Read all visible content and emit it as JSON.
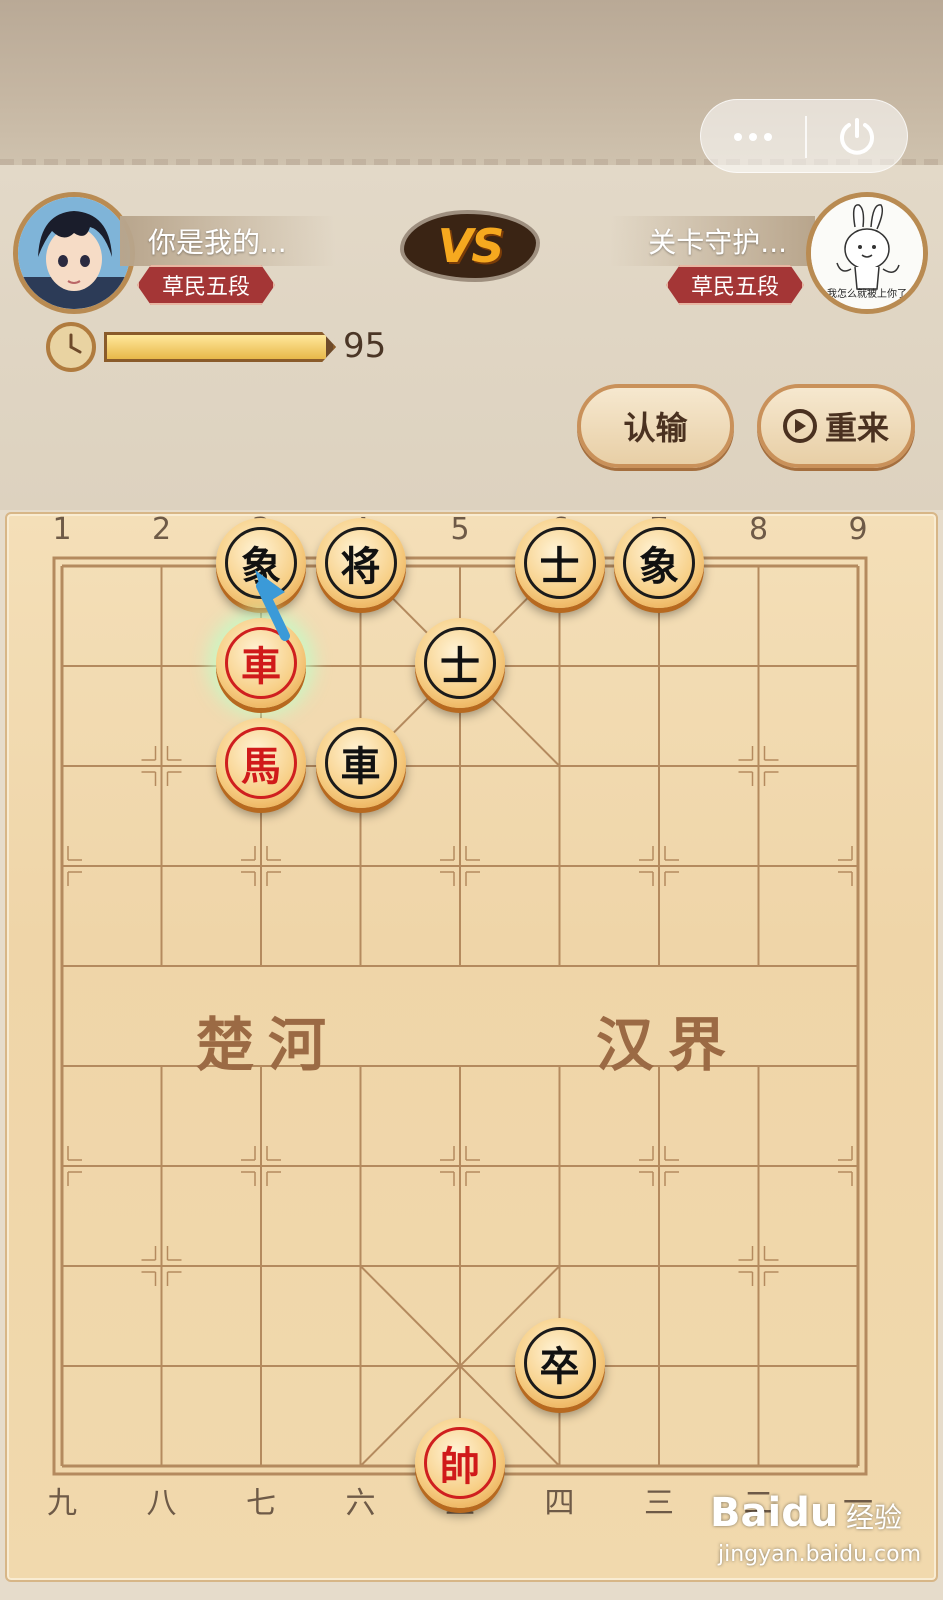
{
  "colors": {
    "red_piece": "#d01a1a",
    "black_piece": "#111111",
    "board": "#f1d9ad",
    "rank_badge": "#a43636",
    "vs": "#f6a91f"
  },
  "player_self": {
    "name": "你是我的...",
    "rank": "草民五段"
  },
  "player_opponent": {
    "name": "关卡守护...",
    "rank": "草民五段",
    "avatar_caption": "我怎么就被上你了"
  },
  "vs_label": "VS",
  "timer": {
    "value": "95",
    "fill_fraction": 0.97
  },
  "buttons": {
    "resign": "认输",
    "restart": "重来"
  },
  "capsule": {
    "more_icon": "more-dots-icon",
    "close_icon": "power-icon"
  },
  "board": {
    "top_files": [
      "1",
      "2",
      "3",
      "4",
      "5",
      "6",
      "7",
      "8",
      "9"
    ],
    "bottom_files": [
      "九",
      "八",
      "七",
      "六",
      "五",
      "四",
      "三",
      "二",
      "一"
    ],
    "river_left": "楚河",
    "river_right": "汉界",
    "pieces": [
      {
        "label": "象",
        "side": "black",
        "file": 2,
        "rank": 0
      },
      {
        "label": "将",
        "side": "black",
        "file": 3,
        "rank": 0
      },
      {
        "label": "士",
        "side": "black",
        "file": 5,
        "rank": 0
      },
      {
        "label": "象",
        "side": "black",
        "file": 6,
        "rank": 0
      },
      {
        "label": "車",
        "side": "red",
        "file": 2,
        "rank": 1,
        "selected": true
      },
      {
        "label": "士",
        "side": "black",
        "file": 4,
        "rank": 1
      },
      {
        "label": "馬",
        "side": "red",
        "file": 2,
        "rank": 2
      },
      {
        "label": "車",
        "side": "black",
        "file": 3,
        "rank": 2
      },
      {
        "label": "卒",
        "side": "black",
        "file": 5,
        "rank": 8
      },
      {
        "label": "帥",
        "side": "red",
        "file": 4,
        "rank": 9
      }
    ],
    "move_arrow": {
      "from": [
        2,
        1
      ],
      "to": [
        2,
        0
      ]
    }
  },
  "watermark": {
    "brand": "Baidu",
    "sub": "经验",
    "url": "jingyan.baidu.com"
  }
}
